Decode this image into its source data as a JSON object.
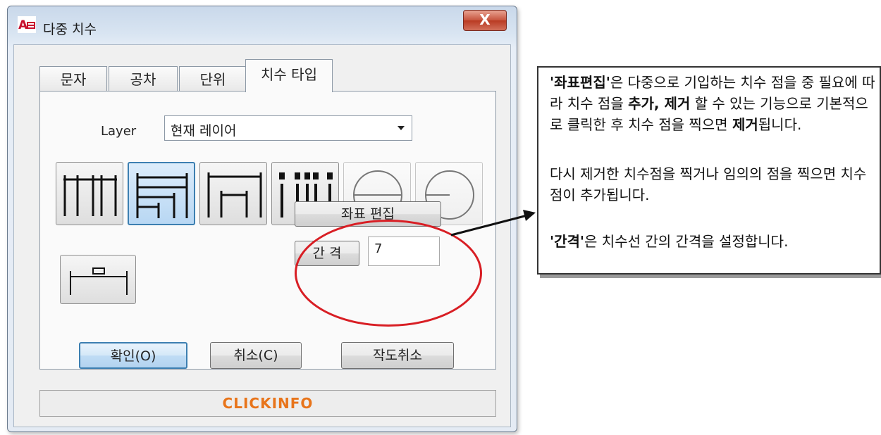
{
  "window": {
    "title": "다중 치수",
    "close_label": "X",
    "icon": "autocad-app-icon"
  },
  "tabs": [
    {
      "label": "문자",
      "active": false
    },
    {
      "label": "공차",
      "active": false
    },
    {
      "label": "단위",
      "active": false
    },
    {
      "label": "치수 타입",
      "active": true
    }
  ],
  "layer": {
    "label": "Layer",
    "value": "현재 레이어"
  },
  "dimension_types": [
    {
      "icon": "baseline-multi-dim-icon",
      "selected": false,
      "enabled": true
    },
    {
      "icon": "stacked-parallel-dim-icon",
      "selected": true,
      "enabled": true
    },
    {
      "icon": "chain-dim-icon",
      "selected": false,
      "enabled": true
    },
    {
      "icon": "ordinate-dim-icon",
      "selected": false,
      "enabled": true
    },
    {
      "icon": "diameter-dim-icon",
      "selected": false,
      "enabled": false
    },
    {
      "icon": "radius-dim-icon",
      "selected": false,
      "enabled": false
    },
    {
      "icon": "single-linear-dim-icon",
      "selected": false,
      "enabled": true
    }
  ],
  "coord_edit_label": "좌표 편집",
  "spacing": {
    "label": "간 격",
    "value": "7"
  },
  "buttons": {
    "ok": "확인(O)",
    "cancel": "취소(C)",
    "cancel_draw": "작도취소"
  },
  "footer_brand": "CLICKINFO",
  "colors": {
    "highlight_ellipse": "#d81e24",
    "brand": "#e8741a",
    "selected_blue": "#3c7fb1"
  },
  "callout": {
    "para1_b1": "'좌표편집'",
    "para1_t1": "은 다중으로 기입하는 치수 점을 중 필요에 따라 치수 점을 ",
    "para1_b2": "추가, 제거",
    "para1_t2": " 할 수 있는 기능으로 기본적으로 클릭한 후 치수 점을 찍으면 ",
    "para1_b3": "제거",
    "para1_t3": "됩니다.",
    "para2": "다시 제거한 치수점을 찍거나 임의의 점을 찍으면 치수 점이 추가됩니다.",
    "para3_b": "'간격'",
    "para3_t": "은 치수선 간의 간격을 설정합니다."
  }
}
